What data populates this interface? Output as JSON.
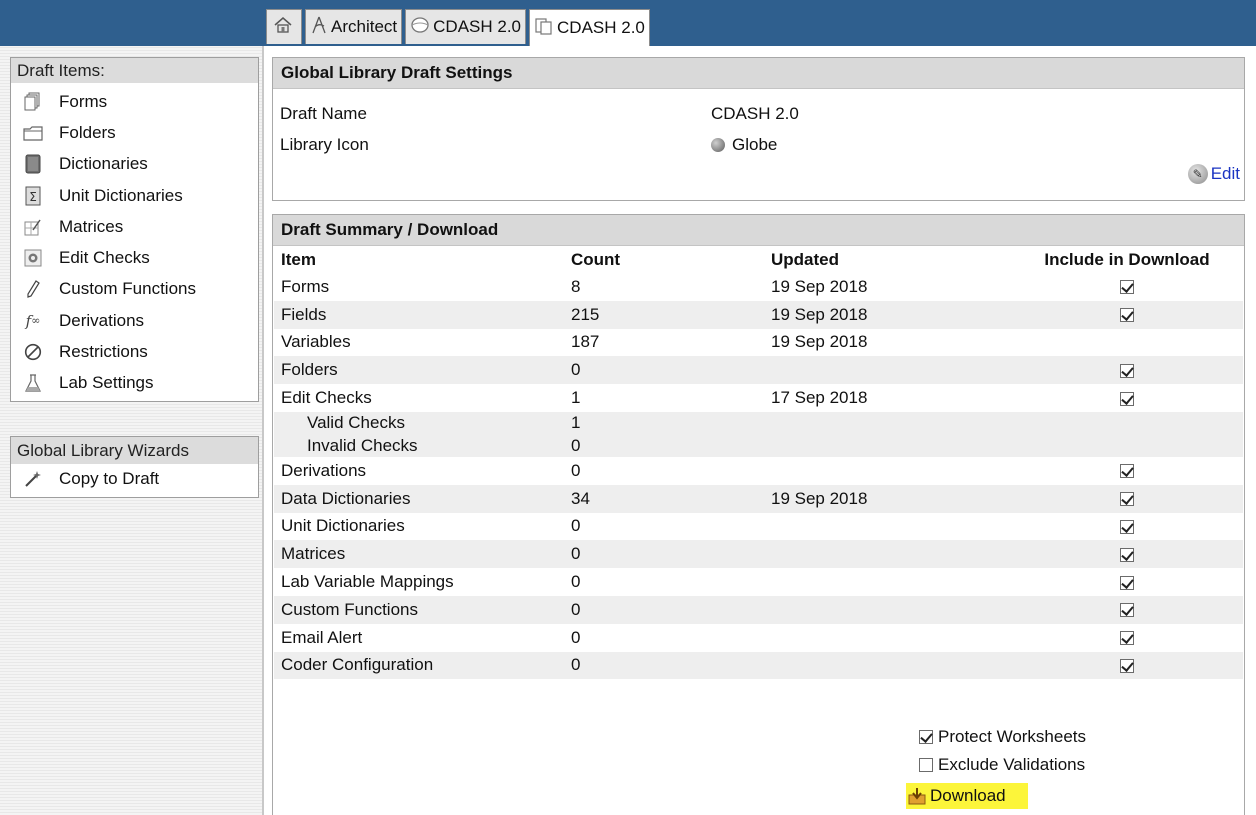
{
  "tabs": [
    {
      "icon": "home-icon",
      "label": ""
    },
    {
      "icon": "architect-icon",
      "label": "Architect"
    },
    {
      "icon": "library-icon",
      "label": "CDASH 2.0"
    },
    {
      "icon": "draft-icon",
      "label": "CDASH 2.0"
    }
  ],
  "sidebar": {
    "draft_header": "Draft Items:",
    "items": [
      {
        "label": "Forms",
        "icon": "forms-icon"
      },
      {
        "label": "Folders",
        "icon": "folder-icon"
      },
      {
        "label": "Dictionaries",
        "icon": "dictionary-icon"
      },
      {
        "label": "Unit Dictionaries",
        "icon": "sigma-icon"
      },
      {
        "label": "Matrices",
        "icon": "matrix-icon"
      },
      {
        "label": "Edit Checks",
        "icon": "gear-icon"
      },
      {
        "label": "Custom Functions",
        "icon": "pen-icon"
      },
      {
        "label": "Derivations",
        "icon": "function-icon"
      },
      {
        "label": "Restrictions",
        "icon": "prohibited-icon"
      },
      {
        "label": "Lab Settings",
        "icon": "flask-icon"
      }
    ],
    "wizard_header": "Global Library Wizards",
    "wizard_items": [
      {
        "label": "Copy to Draft",
        "icon": "wand-icon"
      }
    ]
  },
  "settings": {
    "title": "Global Library Draft Settings",
    "draft_name_label": "Draft Name",
    "draft_name_value": "CDASH 2.0",
    "library_icon_label": "Library Icon",
    "library_icon_value": "Globe",
    "edit_label": "Edit"
  },
  "summary": {
    "title": "Draft Summary / Download",
    "columns": [
      "Item",
      "Count",
      "Updated",
      "Include in Download"
    ],
    "rows": [
      {
        "item": "Forms",
        "count": "8",
        "updated": "19 Sep 2018",
        "checkbox": true,
        "checked": true
      },
      {
        "item": "Fields",
        "count": "215",
        "updated": "19 Sep 2018",
        "checkbox": true,
        "checked": true
      },
      {
        "item": "Variables",
        "count": "187",
        "updated": "19 Sep 2018",
        "checkbox": false
      },
      {
        "item": "Folders",
        "count": "0",
        "updated": "",
        "checkbox": true,
        "checked": true
      },
      {
        "item": "Edit Checks",
        "count": "1",
        "updated": "17 Sep 2018",
        "checkbox": true,
        "checked": true
      },
      {
        "item": "Valid Checks",
        "count": "1",
        "updated": "",
        "checkbox": false,
        "sub": true
      },
      {
        "item": "Invalid Checks",
        "count": "0",
        "updated": "",
        "checkbox": false,
        "sub": true
      },
      {
        "item": "Derivations",
        "count": "0",
        "updated": "",
        "checkbox": true,
        "checked": true
      },
      {
        "item": "Data Dictionaries",
        "count": "34",
        "updated": "19 Sep 2018",
        "checkbox": true,
        "checked": true
      },
      {
        "item": "Unit Dictionaries",
        "count": "0",
        "updated": "",
        "checkbox": true,
        "checked": true
      },
      {
        "item": "Matrices",
        "count": "0",
        "updated": "",
        "checkbox": true,
        "checked": true
      },
      {
        "item": "Lab Variable Mappings",
        "count": "0",
        "updated": "",
        "checkbox": true,
        "checked": true
      },
      {
        "item": "Custom Functions",
        "count": "0",
        "updated": "",
        "checkbox": true,
        "checked": true
      },
      {
        "item": "Email Alert",
        "count": "0",
        "updated": "",
        "checkbox": true,
        "checked": true
      },
      {
        "item": "Coder Configuration",
        "count": "0",
        "updated": "",
        "checkbox": true,
        "checked": true
      }
    ],
    "row_shading": [
      false,
      true,
      false,
      true,
      false,
      true,
      true,
      false,
      true,
      false,
      true,
      false,
      true,
      false,
      true
    ]
  },
  "options": {
    "protect_label": "Protect Worksheets",
    "protect_checked": true,
    "exclude_label": "Exclude Validations",
    "exclude_checked": false,
    "download_label": "Download",
    "highlight_color": "#fcf53a"
  },
  "colors": {
    "topbar": "#2f5f8e",
    "link": "#1a33c2"
  }
}
